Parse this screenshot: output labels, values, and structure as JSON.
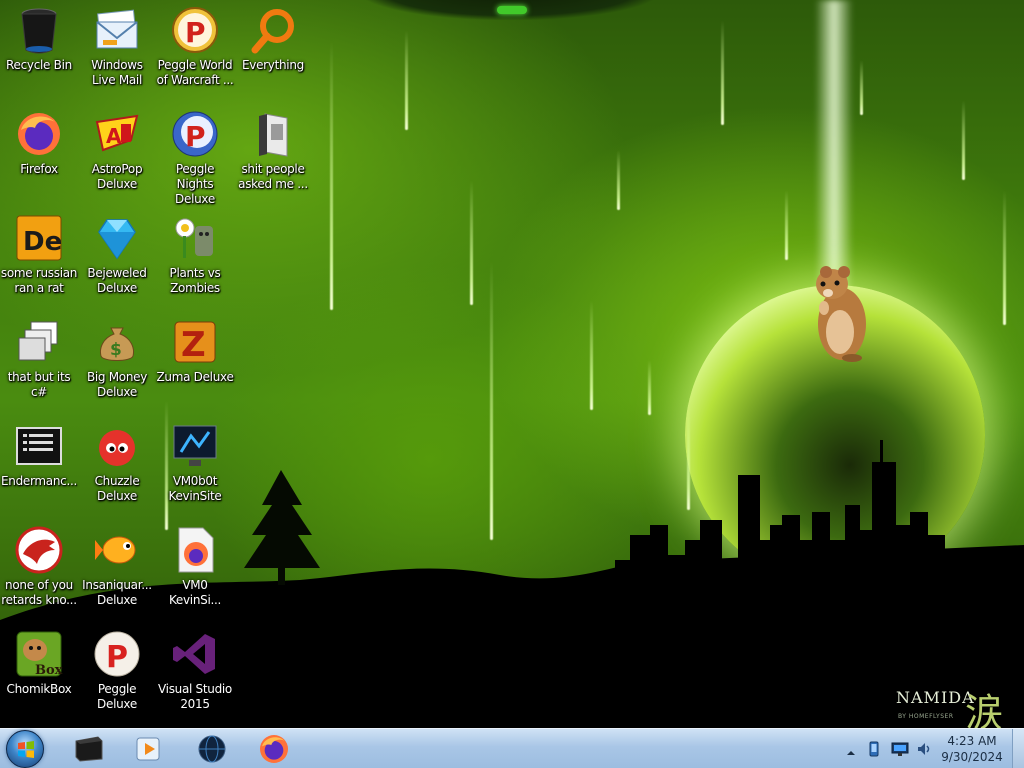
{
  "desktop": {
    "wallpaper": {
      "brand_text": "NAMIDA",
      "brand_sub": "BY HOMEFLYSER",
      "brand_kanji": "涙",
      "accent_color": "#7fd31b"
    },
    "icons": [
      {
        "label": "Recycle Bin",
        "icon": "recycle-bin-icon"
      },
      {
        "label": "Windows Live Mail",
        "icon": "mail-icon"
      },
      {
        "label": "Peggle World of Warcraft ...",
        "icon": "peggle-icon"
      },
      {
        "label": "Everything",
        "icon": "magnifier-icon"
      },
      {
        "label": "Firefox",
        "icon": "firefox-icon"
      },
      {
        "label": "AstroPop Deluxe",
        "icon": "astropop-icon"
      },
      {
        "label": "Peggle Nights Deluxe",
        "icon": "peggle-nights-icon"
      },
      {
        "label": "shit people asked me ...",
        "icon": "folder-icon"
      },
      {
        "label": "some russian ran a rat",
        "icon": "de-app-icon"
      },
      {
        "label": "Bejeweled Deluxe",
        "icon": "gem-icon"
      },
      {
        "label": "Plants vs Zombies",
        "icon": "plant-icon"
      },
      {
        "label": "that but its c#",
        "icon": "window-stack-icon"
      },
      {
        "label": "Big Money Deluxe",
        "icon": "money-bag-icon"
      },
      {
        "label": "Zuma Deluxe",
        "icon": "zuma-icon"
      },
      {
        "label": "Endermanc...",
        "icon": "console-icon"
      },
      {
        "label": "Chuzzle Deluxe",
        "icon": "chuzzle-icon"
      },
      {
        "label": "VM0b0t KevinSite",
        "icon": "monitor-icon"
      },
      {
        "label": "none of you retards kno...",
        "icon": "lizard-icon"
      },
      {
        "label": "Insaniquar... Deluxe",
        "icon": "fish-icon"
      },
      {
        "label": "VM0 KevinSi...",
        "icon": "firefox-file-icon"
      },
      {
        "label": "ChomikBox",
        "icon": "chomikbox-icon"
      },
      {
        "label": "Peggle Deluxe",
        "icon": "peggle-deluxe-icon"
      },
      {
        "label": "Visual Studio 2015",
        "icon": "visual-studio-icon"
      }
    ]
  },
  "taskbar": {
    "pinned": [
      {
        "name": "taskbar-terminal",
        "icon": "terminal-icon"
      },
      {
        "name": "taskbar-media-player",
        "icon": "media-player-icon"
      },
      {
        "name": "taskbar-globe",
        "icon": "globe-icon"
      },
      {
        "name": "taskbar-firefox",
        "icon": "firefox-icon"
      }
    ],
    "tray": {
      "time": "4:23 AM",
      "date": "9/30/2024"
    }
  }
}
